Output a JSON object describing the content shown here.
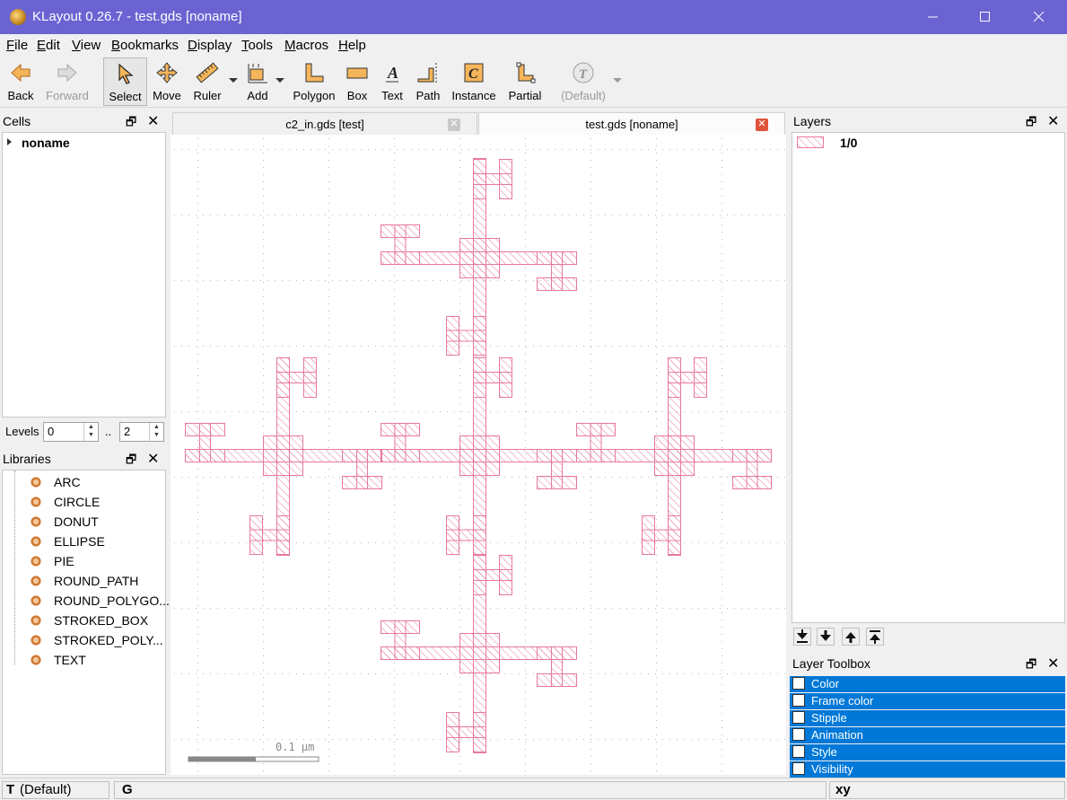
{
  "window": {
    "title": "KLayout 0.26.7 - test.gds [noname]"
  },
  "menu": [
    "File",
    "Edit",
    "View",
    "Bookmarks",
    "Display",
    "Tools",
    "Macros",
    "Help"
  ],
  "toolbar": {
    "back": "Back",
    "forward": "Forward",
    "select": "Select",
    "move": "Move",
    "ruler": "Ruler",
    "add": "Add",
    "polygon": "Polygon",
    "box": "Box",
    "text": "Text",
    "path": "Path",
    "instance": "Instance",
    "partial": "Partial",
    "default": "(Default)"
  },
  "cells": {
    "title": "Cells",
    "items": [
      "noname"
    ]
  },
  "levels": {
    "label": "Levels",
    "from": "0",
    "sep": "..",
    "to": "2"
  },
  "libraries": {
    "title": "Libraries",
    "items": [
      "ARC",
      "CIRCLE",
      "DONUT",
      "ELLIPSE",
      "PIE",
      "ROUND_PATH",
      "ROUND_POLYGO...",
      "STROKED_BOX",
      "STROKED_POLY...",
      "TEXT"
    ]
  },
  "tabs": [
    {
      "label": "c2_in.gds [test]",
      "active": false
    },
    {
      "label": "test.gds [noname]",
      "active": true
    }
  ],
  "canvas": {
    "scale_label": "0.1 µm",
    "layer_color": "#e8799c"
  },
  "layers": {
    "title": "Layers",
    "items": [
      {
        "name": "1/0",
        "color": "#e8799c"
      }
    ]
  },
  "layer_toolbox": {
    "title": "Layer Toolbox",
    "rows": [
      "Color",
      "Frame color",
      "Stipple",
      "Animation",
      "Style",
      "Visibility"
    ]
  },
  "status": {
    "t": "T",
    "default": "(Default)",
    "g": "G",
    "xy": "xy"
  },
  "colors": {
    "titlebar": "#6b63d2",
    "selection": "#0078d7"
  }
}
